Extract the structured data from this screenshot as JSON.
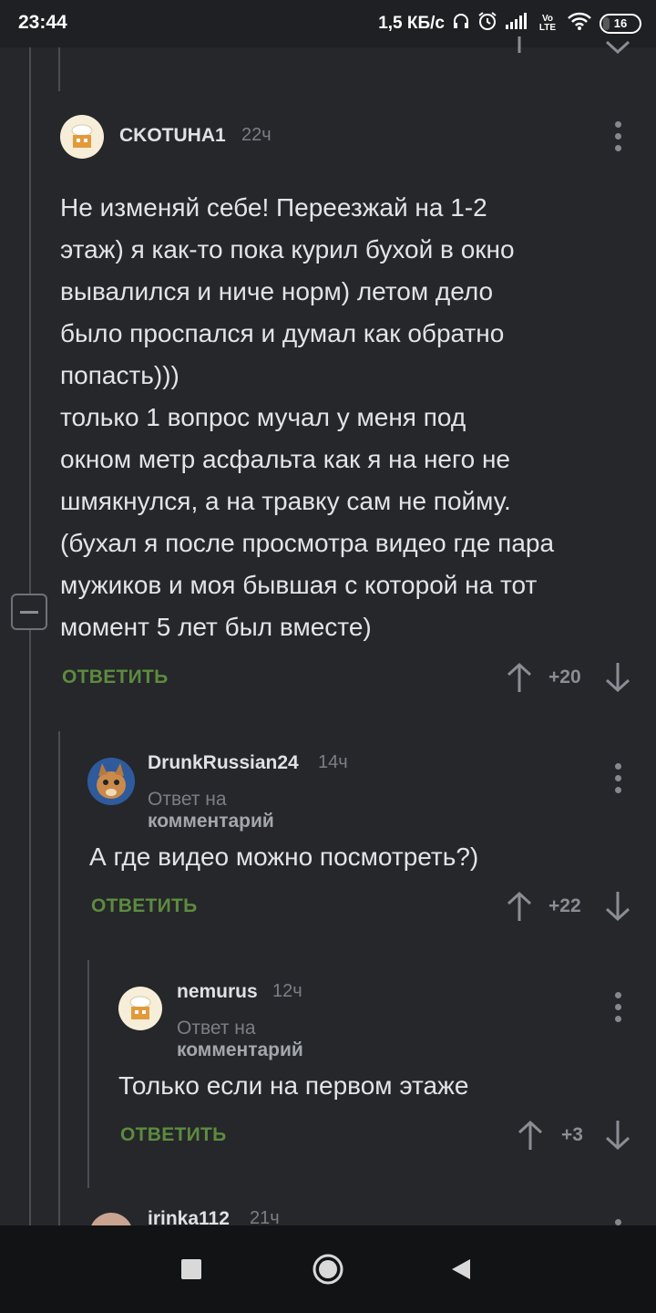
{
  "status_bar": {
    "time": "23:44",
    "speed": "1,5 КБ/с",
    "volte": "Vo LTE",
    "battery": "16",
    "battery_level": 0.16
  },
  "comments": [
    {
      "author": "CKOTUHA1",
      "time": "22ч",
      "body": "Не изменяй себе! Переезжай на 1-2\nэтаж) я как-то пока курил бухой в окно\nвывалился и ниче норм) летом дело\nбыло проспался и думал как обратно\nпопасть)))\nтолько 1 вопрос мучал у меня под\nокном метр асфальта как я на него не\nшмякнулся, а на травку сам не пойму.\n(бухал я после просмотра видео где пара\nмужиков и моя бывшая с которой на тот\nмомент 5 лет был вместе)",
      "reply_label": "ОТВЕТИТЬ",
      "rating": "+20"
    },
    {
      "author": "DrunkRussian24",
      "time": "14ч",
      "reply_prefix": "Ответ на",
      "reply_target": "комментарий",
      "body": "А где видео можно посмотреть?)",
      "reply_label": "ОТВЕТИТЬ",
      "rating": "+22"
    },
    {
      "author": "nemurus",
      "time": "12ч",
      "reply_prefix": "Ответ на",
      "reply_target": "комментарий",
      "body": "Только если на первом этаже",
      "reply_label": "ОТВЕТИТЬ",
      "rating": "+3"
    },
    {
      "author": "irinka112",
      "time": "21ч"
    }
  ],
  "icons": {
    "headphones": "headphones-icon",
    "alarm": "alarm-icon",
    "signal": "signal-icon",
    "wifi": "wifi-icon",
    "battery": "battery-icon",
    "upvote": "arrow-up-icon",
    "downvote": "arrow-down-icon",
    "more": "more-vertical-icon",
    "collapse": "collapse-minus-icon",
    "nav_recent": "recent-apps-icon",
    "nav_home": "home-icon",
    "nav_back": "back-icon"
  },
  "colors": {
    "background": "#25272b",
    "reply_green": "#5d8b3e",
    "muted": "#7b7f85"
  }
}
